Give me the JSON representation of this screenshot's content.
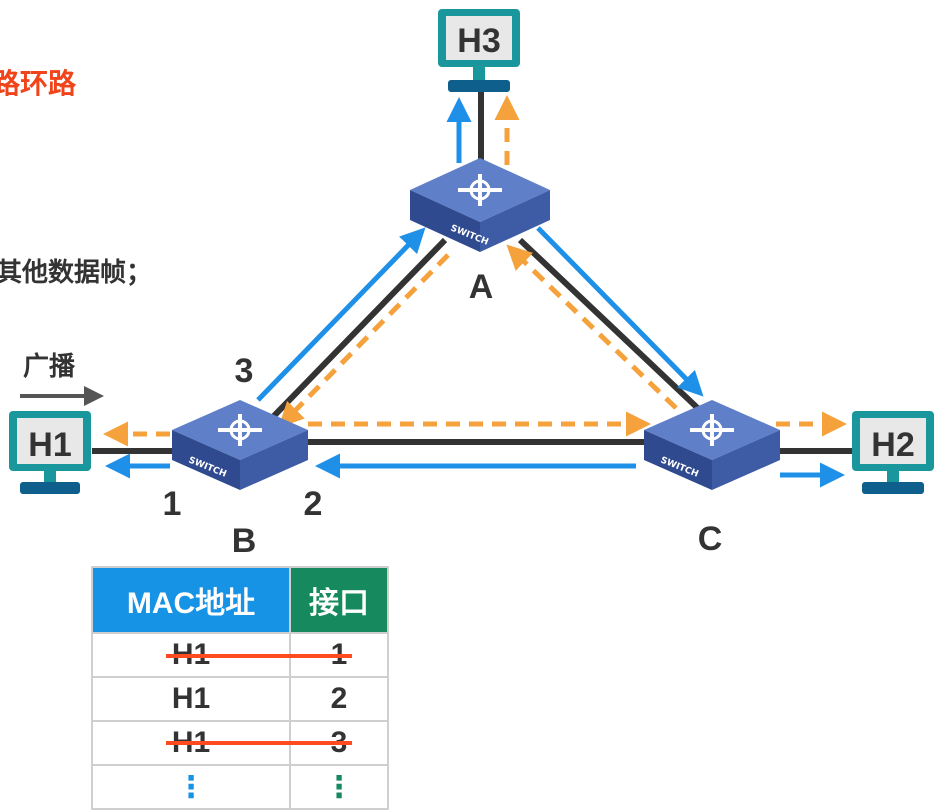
{
  "header_fragment": "路环路",
  "left_fragment": "其他数据帧；",
  "broadcast_label": "广播",
  "hosts": {
    "h1": "H1",
    "h2": "H2",
    "h3": "H3"
  },
  "switches": {
    "a": "A",
    "b": "B",
    "c": "C",
    "chassis_text": "SWITCH"
  },
  "ports": {
    "p1": "1",
    "p2": "2",
    "p3": "3"
  },
  "table": {
    "headers": {
      "mac": "MAC地址",
      "port": "接口"
    },
    "rows": [
      {
        "mac": "H1",
        "port": "1",
        "struck": true
      },
      {
        "mac": "H1",
        "port": "2",
        "struck": false
      },
      {
        "mac": "H1",
        "port": "3",
        "struck": true
      },
      {
        "mac": "⋮",
        "port": "⋮",
        "struck": false
      }
    ]
  },
  "colors": {
    "accent_red": "#ff4b1f",
    "header_blue": "#1793e6",
    "header_green": "#168a5e",
    "switch_blue": "#2f4a8f",
    "host_teal": "#19979c",
    "arrow_blue": "#1e90e8",
    "arrow_orange": "#f5a23c",
    "line_dark": "#333333"
  }
}
